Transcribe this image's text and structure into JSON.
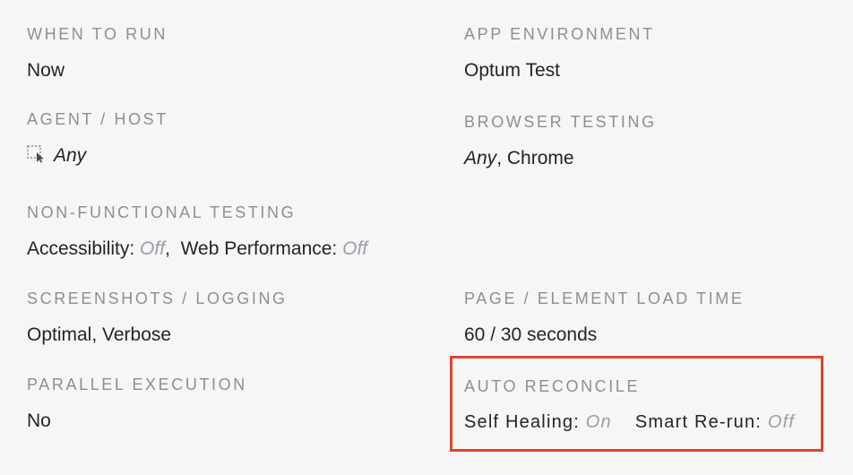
{
  "when_to_run": {
    "label": "WHEN TO RUN",
    "value": "Now"
  },
  "app_environment": {
    "label": "APP ENVIRONMENT",
    "value": "Optum Test"
  },
  "agent_host": {
    "label": "AGENT / HOST",
    "icon": "selection-cursor-icon",
    "value": "Any"
  },
  "browser_testing": {
    "label": "BROWSER TESTING",
    "any": "Any",
    "separator": ",",
    "browser": "Chrome"
  },
  "non_functional": {
    "label": "NON-FUNCTIONAL TESTING",
    "accessibility_label": "Accessibility:",
    "accessibility_value": "Off",
    "separator": ",",
    "performance_label": "Web Performance:",
    "performance_value": "Off"
  },
  "screenshots_logging": {
    "label": "SCREENSHOTS / LOGGING",
    "value": "Optimal, Verbose"
  },
  "page_load_time": {
    "label": "PAGE / ELEMENT LOAD TIME",
    "value": "60 / 30 seconds"
  },
  "parallel_execution": {
    "label": "PARALLEL EXECUTION",
    "value": "No"
  },
  "auto_reconcile": {
    "label": "AUTO RECONCILE",
    "self_healing_label": "Self Healing:",
    "self_healing_value": "On",
    "smart_rerun_label": "Smart Re-run:",
    "smart_rerun_value": "Off"
  },
  "colors": {
    "background": "#f6f6f7",
    "label": "#8b8f95",
    "value": "#222426",
    "muted_value": "#9aa0a6",
    "highlight_border": "#e2432b"
  }
}
